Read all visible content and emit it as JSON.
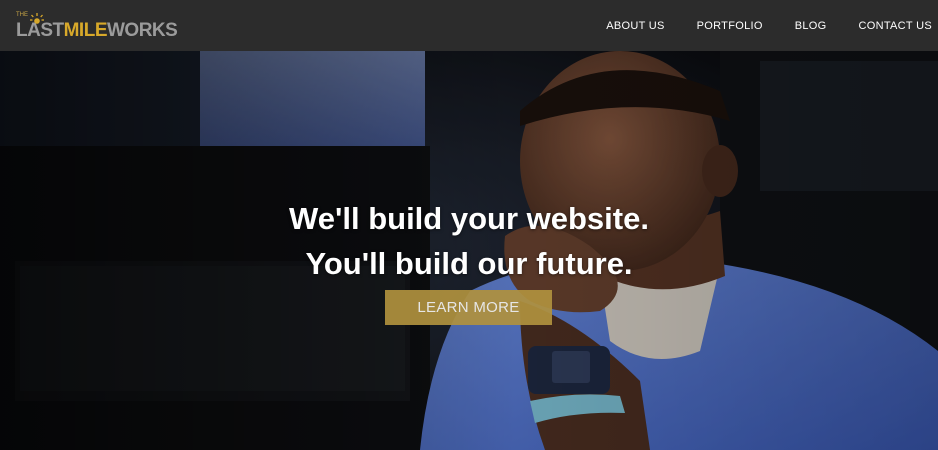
{
  "brand": {
    "logo_the": "THE",
    "logo_last": "LAST",
    "logo_mile": "MILE",
    "logo_works": "WORKS",
    "colors": {
      "gold": "#d8a92a",
      "gray": "#9b9b9b"
    }
  },
  "nav": {
    "items": [
      {
        "label": "ABOUT US"
      },
      {
        "label": "PORTFOLIO"
      },
      {
        "label": "BLOG"
      },
      {
        "label": "CONTACT US"
      }
    ]
  },
  "hero": {
    "headline_line1": "We'll build your website.",
    "headline_line2": "You'll build our future.",
    "cta_label": "LEARN MORE",
    "cta_color": "#b0913e",
    "background_image": "man-in-blue-shirt-looking-up-at-screens"
  }
}
